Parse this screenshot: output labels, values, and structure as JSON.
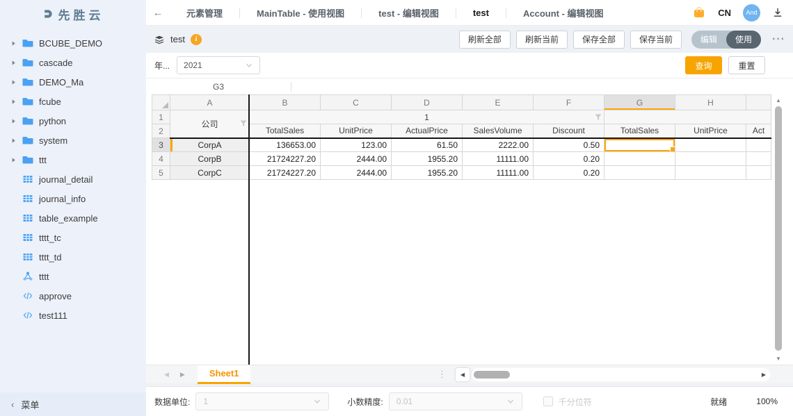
{
  "colors": {
    "accent_orange": "#F7A400",
    "selection_orange": "#FFA600",
    "icon_blue": "#4BA1F2",
    "toggle_active": "#59656F",
    "toggle_inactive": "#B6C3CD",
    "avatar_blue": "#70B4F1",
    "logo_slate": "#5F7D91",
    "sidebar_bg": "#EDF1FA"
  },
  "sidebar": {
    "logo_text": "先胜云",
    "menu_label": "菜单",
    "menu_collapse_icon": "‹",
    "items": [
      {
        "label": "BCUBE_DEMO",
        "type": "folder"
      },
      {
        "label": "cascade",
        "type": "folder"
      },
      {
        "label": "DEMO_Ma",
        "type": "folder"
      },
      {
        "label": "fcube",
        "type": "folder"
      },
      {
        "label": "python",
        "type": "folder"
      },
      {
        "label": "system",
        "type": "folder"
      },
      {
        "label": "ttt",
        "type": "folder"
      },
      {
        "label": "journal_detail",
        "type": "table"
      },
      {
        "label": "journal_info",
        "type": "table"
      },
      {
        "label": "table_example",
        "type": "table"
      },
      {
        "label": "tttt_tc",
        "type": "table"
      },
      {
        "label": "tttt_td",
        "type": "table"
      },
      {
        "label": "tttt",
        "type": "graph"
      },
      {
        "label": "approve",
        "type": "code"
      },
      {
        "label": "test111",
        "type": "code"
      }
    ]
  },
  "topbar": {
    "back_icon": "←",
    "tabs": [
      {
        "label": "元素管理"
      },
      {
        "label": "MainTable - 使用视图"
      },
      {
        "label": "test - 编辑视图"
      },
      {
        "label": "test",
        "active": true
      },
      {
        "label": "Account - 编辑视图"
      }
    ],
    "lang": "CN",
    "avatar_initials": "And"
  },
  "toolbar": {
    "title": "test",
    "info_icon": "i",
    "refresh_all": "刷新全部",
    "refresh_current": "刷新当前",
    "save_all": "保存全部",
    "save_current": "保存当前",
    "toggle_edit": "编辑",
    "toggle_use": "使用",
    "more_icon": "···"
  },
  "query": {
    "field_label": "年...",
    "value": "2021",
    "search_btn": "查询",
    "reset_btn": "重置"
  },
  "formula": {
    "cell_ref": "G3",
    "value": ""
  },
  "grid": {
    "col_letters": [
      "A",
      "B",
      "C",
      "D",
      "E",
      "F",
      "G",
      "H"
    ],
    "selected_column": "G",
    "selected_cell": "G3",
    "header": {
      "r1_num": "1",
      "r2_num": "2",
      "company_label": "公司",
      "group_label": "1",
      "fields": [
        "TotalSales",
        "UnitPrice",
        "ActualPrice",
        "SalesVolume",
        "Discount",
        "TotalSales",
        "UnitPrice",
        "Act"
      ]
    },
    "rows": [
      {
        "num": "3",
        "company": "CorpA",
        "cells": [
          "136653.00",
          "123.00",
          "61.50",
          "2222.00",
          "0.50",
          "",
          "",
          ""
        ]
      },
      {
        "num": "4",
        "company": "CorpB",
        "cells": [
          "21724227.20",
          "2444.00",
          "1955.20",
          "11111.00",
          "0.20",
          "",
          "",
          ""
        ]
      },
      {
        "num": "5",
        "company": "CorpC",
        "cells": [
          "21724227.20",
          "2444.00",
          "1955.20",
          "11111.00",
          "0.20",
          "",
          "",
          ""
        ]
      }
    ]
  },
  "scroll": {
    "up_icon": "▲",
    "down_icon": "▼",
    "left_icon": "◀",
    "right_icon": "▶"
  },
  "sheet_bar": {
    "tab": "Sheet1",
    "prev_icon": "◀",
    "next_icon": "▶",
    "dots_icon": "⋮"
  },
  "footer": {
    "unit_label": "数据单位:",
    "unit_value": "1",
    "precision_label": "小数精度:",
    "precision_value": "0.01",
    "thousands_label": "千分位符",
    "status": "就绪",
    "zoom": "100%"
  }
}
